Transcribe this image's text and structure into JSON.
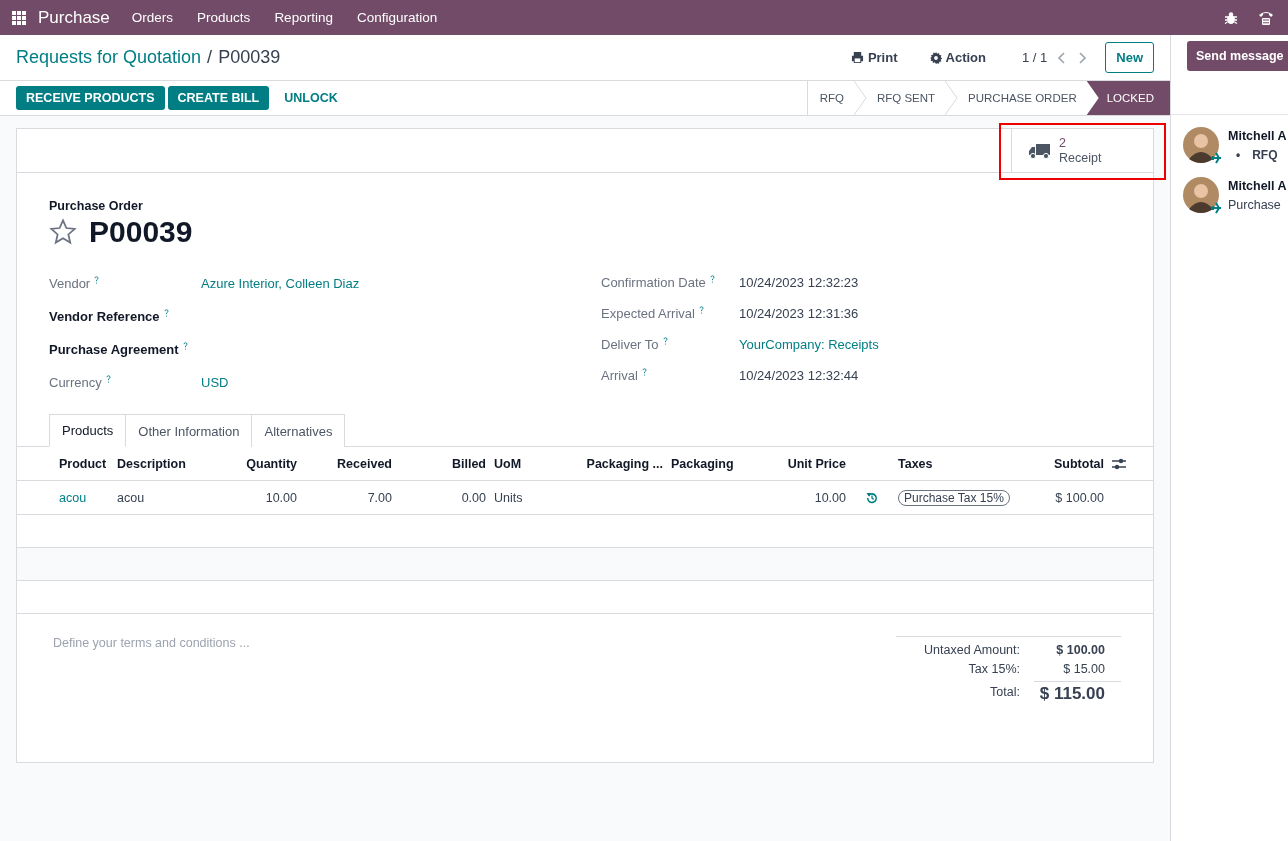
{
  "navbar": {
    "app": "Purchase",
    "menu": [
      "Orders",
      "Products",
      "Reporting",
      "Configuration"
    ]
  },
  "breadcrumb": {
    "parent": "Requests for Quotation",
    "separator": "/",
    "current": "P00039"
  },
  "actions": {
    "print": "Print",
    "action": "Action",
    "pager": "1 / 1",
    "new": "New"
  },
  "buttons": [
    {
      "label": "RECEIVE PRODUCTS",
      "kind": "primary"
    },
    {
      "label": "CREATE BILL",
      "kind": "primary"
    },
    {
      "label": "UNLOCK",
      "kind": "link"
    }
  ],
  "statusbar": [
    {
      "label": "RFQ",
      "selected": false
    },
    {
      "label": "RFQ SENT",
      "selected": false
    },
    {
      "label": "PURCHASE ORDER",
      "selected": false
    },
    {
      "label": "LOCKED",
      "selected": true
    }
  ],
  "smart_button": {
    "count": "2",
    "label": "Receipt",
    "highlighted": true
  },
  "form": {
    "subtitle": "Purchase Order",
    "name": "P00039",
    "starred": false,
    "left_fields": [
      {
        "label": "Vendor",
        "value": "Azure Interior, Colleen Diaz",
        "link": true,
        "readonly": true
      },
      {
        "label": "Vendor Reference",
        "readonly": false
      },
      {
        "label": "Purchase Agreement",
        "readonly": false
      },
      {
        "label": "Currency",
        "value": "USD",
        "link": true,
        "readonly": true
      }
    ],
    "right_fields": [
      {
        "label": "Confirmation Date",
        "value": "10/24/2023 12:32:23",
        "link": false,
        "readonly": true
      },
      {
        "label": "Expected Arrival",
        "value": "10/24/2023 12:31:36",
        "link": false,
        "readonly": true
      },
      {
        "label": "Deliver To",
        "value": "YourCompany: Receipts",
        "link": true,
        "readonly": true
      },
      {
        "label": "Arrival",
        "value": "10/24/2023 12:32:44",
        "link": false,
        "readonly": true
      }
    ]
  },
  "tabs": [
    {
      "label": "Products",
      "selected": true
    },
    {
      "label": "Other Information",
      "selected": false
    },
    {
      "label": "Alternatives",
      "selected": false
    }
  ],
  "table": {
    "columns": [
      {
        "label": "Product",
        "kind": "link"
      },
      {
        "label": "Description",
        "kind": "text"
      },
      {
        "label": "Quantity",
        "kind": "number"
      },
      {
        "label": "Received",
        "kind": "number"
      },
      {
        "label": "Billed",
        "kind": "number"
      },
      {
        "label": "UoM",
        "kind": "text"
      },
      {
        "label": "Packaging ...",
        "kind": "number"
      },
      {
        "label": "Packaging",
        "kind": "text"
      },
      {
        "label": "Unit Price",
        "kind": "number"
      },
      {
        "kind": "icon"
      },
      {
        "label": "Taxes",
        "kind": "tags"
      },
      {
        "label": "Subtotal",
        "kind": "number"
      }
    ],
    "rows": [
      {
        "cells": [
          "acou",
          "acou",
          "10.00",
          "7.00",
          "0.00",
          "Units",
          null,
          null,
          "10.00",
          null,
          [
            "Purchase Tax 15%"
          ],
          "$ 100.00"
        ]
      }
    ]
  },
  "terms_placeholder": "Define your terms and conditions ...",
  "totals": [
    {
      "label": "Untaxed Amount:",
      "value": "$ 100.00",
      "kind": "subtotal"
    },
    {
      "label": "Tax 15%:",
      "value": "$ 15.00",
      "kind": "tax"
    },
    {
      "label": "Total:",
      "value": "$ 115.00",
      "kind": "total"
    }
  ],
  "chatter": {
    "send": "Send message",
    "messages": [
      {
        "author": "Mitchell A",
        "marker": "•",
        "items": [
          "RFQ"
        ]
      },
      {
        "author": "Mitchell A",
        "body": "Purchase"
      }
    ]
  }
}
